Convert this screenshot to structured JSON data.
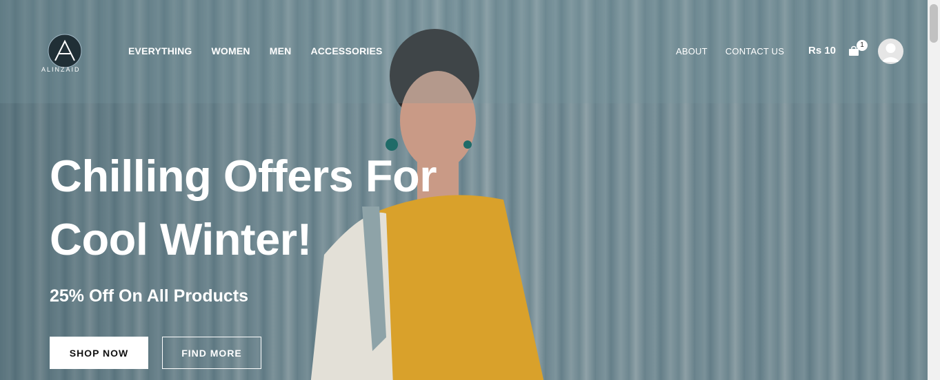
{
  "brand": {
    "logo_text": "ALINZAID"
  },
  "nav": {
    "main": [
      "EVERYTHING",
      "WOMEN",
      "MEN",
      "ACCESSORIES"
    ],
    "secondary": [
      "ABOUT",
      "CONTACT US"
    ]
  },
  "cart": {
    "total": "Rs 10",
    "count": "1"
  },
  "hero": {
    "headline_line1": "Chilling Offers For",
    "headline_line2": "Cool Winter!",
    "subheadline": "25% Off On All Products",
    "primary_button": "SHOP NOW",
    "secondary_button": "FIND MORE"
  },
  "icons": {
    "cart": "shopping-bag-icon",
    "user": "user-avatar-icon"
  },
  "colors": {
    "text_light": "#ffffff",
    "button_primary_bg": "#ffffff",
    "button_primary_text": "#111111"
  }
}
